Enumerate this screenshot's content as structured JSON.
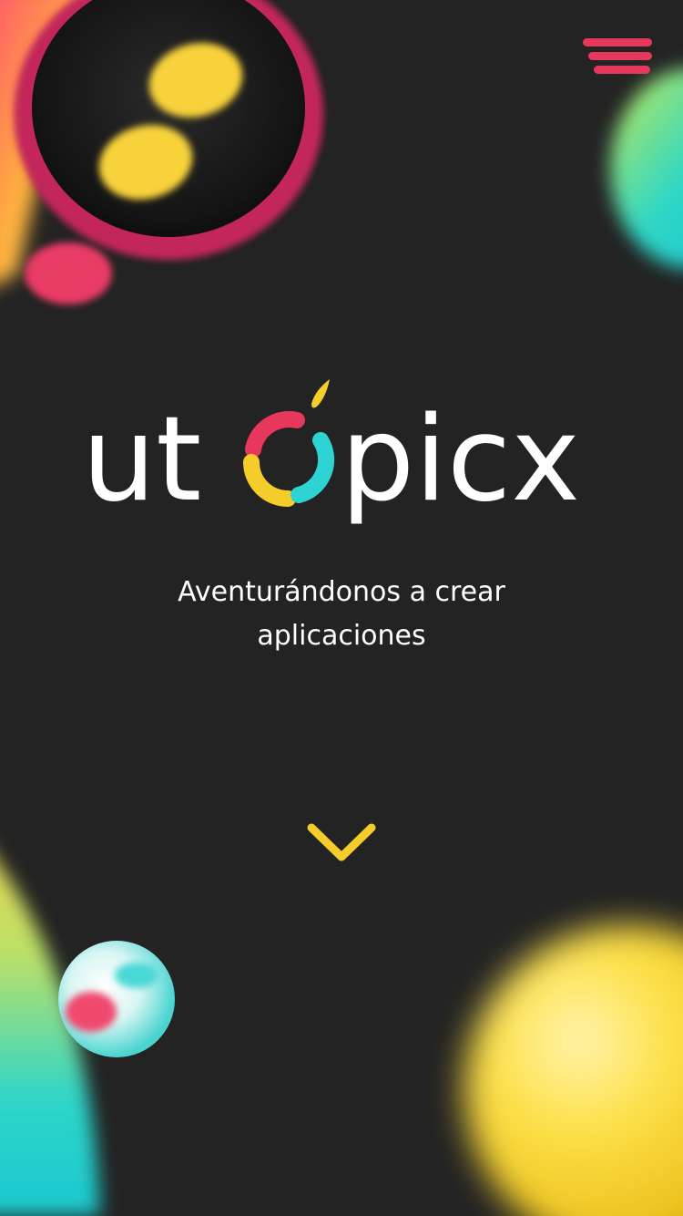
{
  "brand": {
    "name": "utópicx",
    "letters_before": "ut",
    "letters_after": "picx"
  },
  "hero": {
    "tagline_line1": "Aventurándonos a crear",
    "tagline_line2": "aplicaciones"
  },
  "icons": {
    "menu": "hamburger-menu-icon",
    "scroll": "chevron-down-icon"
  },
  "colors": {
    "background": "#232323",
    "pink": "#e8375d",
    "yellow": "#f5cd2a",
    "teal": "#2ed3d3",
    "text": "#ffffff"
  }
}
